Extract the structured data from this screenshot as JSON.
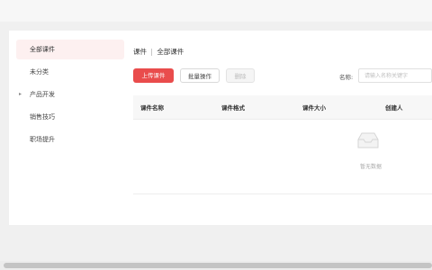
{
  "sidebar": {
    "items": [
      {
        "label": "全部课件",
        "active": true
      },
      {
        "label": "未分类"
      },
      {
        "label": "产品开发",
        "expandable": true
      },
      {
        "label": "销售技巧"
      },
      {
        "label": "职场提升"
      }
    ],
    "expand_arrow": "▸"
  },
  "breadcrumb": {
    "section": "课件",
    "separator": "|",
    "current": "全部课件"
  },
  "toolbar": {
    "upload_label": "上传课件",
    "batch_label": "批量操作",
    "delete_label": "删除"
  },
  "search": {
    "label": "名称:",
    "placeholder": "请输入名称关键字",
    "value": ""
  },
  "table": {
    "columns": [
      "课件名称",
      "课件格式",
      "课件大小",
      "创建人"
    ],
    "empty_text": "暂无数据"
  },
  "colors": {
    "accent": "#e94c4c",
    "active_bg": "#fdf0f0"
  }
}
